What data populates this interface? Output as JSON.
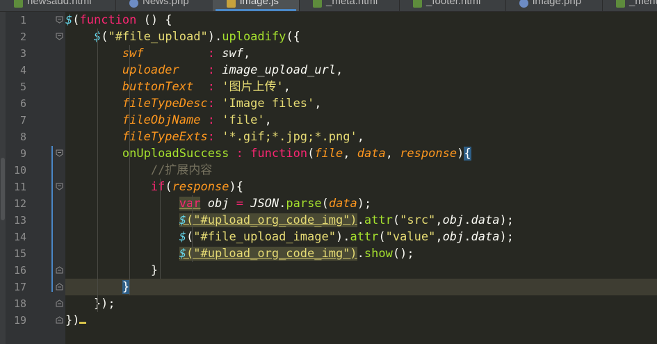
{
  "tabs": [
    {
      "label": "newsadd.html",
      "icon": "html-file-icon",
      "active": false
    },
    {
      "label": "News.php",
      "icon": "php-file-icon",
      "active": false
    },
    {
      "label": "image.js",
      "icon": "js-file-icon",
      "active": true
    },
    {
      "label": "_meta.html",
      "icon": "html-file-icon",
      "active": false
    },
    {
      "label": "_footer.html",
      "icon": "html-file-icon",
      "active": false
    },
    {
      "label": "image.php",
      "icon": "php-file-icon",
      "active": false
    },
    {
      "label": "_menu",
      "icon": "html-file-icon",
      "active": false
    }
  ],
  "line_numbers": [
    "1",
    "2",
    "3",
    "4",
    "5",
    "6",
    "7",
    "8",
    "9",
    "10",
    "11",
    "12",
    "13",
    "14",
    "15",
    "16",
    "17",
    "18",
    "19"
  ],
  "code_lines": [
    [
      [
        "fn",
        "$"
      ],
      [
        "punct",
        "("
      ],
      [
        "kw",
        "function"
      ],
      [
        "punct",
        " () {"
      ]
    ],
    [
      [
        "punct",
        "    "
      ],
      [
        "fn",
        "$"
      ],
      [
        "punct",
        "("
      ],
      [
        "str",
        "\"#file_upload\""
      ],
      [
        "punct",
        ")."
      ],
      [
        "method",
        "uploadify"
      ],
      [
        "punct",
        "({"
      ]
    ],
    [
      [
        "punct",
        "        "
      ],
      [
        "prop",
        "swf"
      ],
      [
        "punct",
        "         "
      ],
      [
        "kw",
        ":"
      ],
      [
        "punct",
        " "
      ],
      [
        "var",
        "swf"
      ],
      [
        "punct",
        ","
      ]
    ],
    [
      [
        "punct",
        "        "
      ],
      [
        "prop",
        "uploader"
      ],
      [
        "punct",
        "    "
      ],
      [
        "kw",
        ":"
      ],
      [
        "punct",
        " "
      ],
      [
        "var",
        "image_upload_url"
      ],
      [
        "punct",
        ","
      ]
    ],
    [
      [
        "punct",
        "        "
      ],
      [
        "prop",
        "buttonText"
      ],
      [
        "punct",
        "  "
      ],
      [
        "kw",
        ":"
      ],
      [
        "punct",
        " "
      ],
      [
        "str",
        "'图片上传'"
      ],
      [
        "punct",
        ","
      ]
    ],
    [
      [
        "punct",
        "        "
      ],
      [
        "prop",
        "fileTypeDesc"
      ],
      [
        "kw",
        ":"
      ],
      [
        "punct",
        " "
      ],
      [
        "str",
        "'Image files'"
      ],
      [
        "punct",
        ","
      ]
    ],
    [
      [
        "punct",
        "        "
      ],
      [
        "prop",
        "fileObjName"
      ],
      [
        "punct",
        " "
      ],
      [
        "kw",
        ":"
      ],
      [
        "punct",
        " "
      ],
      [
        "str",
        "'file'"
      ],
      [
        "punct",
        ","
      ]
    ],
    [
      [
        "punct",
        "        "
      ],
      [
        "prop",
        "fileTypeExts"
      ],
      [
        "kw",
        ":"
      ],
      [
        "punct",
        " "
      ],
      [
        "str",
        "'*.gif;*.jpg;*.png'"
      ],
      [
        "punct",
        ","
      ]
    ],
    [
      [
        "punct",
        "        "
      ],
      [
        "method",
        "onUploadSuccess"
      ],
      [
        "punct",
        " "
      ],
      [
        "kw",
        ":"
      ],
      [
        "punct",
        " "
      ],
      [
        "kw",
        "function"
      ],
      [
        "punct",
        "("
      ],
      [
        "param",
        "file"
      ],
      [
        "punct",
        ", "
      ],
      [
        "param",
        "data"
      ],
      [
        "punct",
        ", "
      ],
      [
        "param",
        "response"
      ],
      [
        "punct",
        ")"
      ],
      [
        "brace",
        "{"
      ]
    ],
    [
      [
        "punct",
        "            "
      ],
      [
        "cmt",
        "//扩展内容"
      ]
    ],
    [
      [
        "punct",
        "            "
      ],
      [
        "kw",
        "if"
      ],
      [
        "punct",
        "("
      ],
      [
        "param",
        "response"
      ],
      [
        "punct",
        "){"
      ]
    ],
    [
      [
        "punct",
        "                "
      ],
      [
        "kwhl",
        "var"
      ],
      [
        "punct",
        " "
      ],
      [
        "var",
        "obj"
      ],
      [
        "punct",
        " "
      ],
      [
        "kw",
        "="
      ],
      [
        "punct",
        " "
      ],
      [
        "var",
        "JSON"
      ],
      [
        "punct",
        "."
      ],
      [
        "method",
        "parse"
      ],
      [
        "punct",
        "("
      ],
      [
        "param",
        "data"
      ],
      [
        "punct",
        ");"
      ]
    ],
    [
      [
        "punct",
        "                "
      ],
      [
        "fnhl",
        "$"
      ],
      [
        "hl",
        "(\"#upload_org_code_img\")"
      ],
      [
        "punct",
        "."
      ],
      [
        "method",
        "attr"
      ],
      [
        "punct",
        "("
      ],
      [
        "str",
        "\"src\""
      ],
      [
        "punct",
        ","
      ],
      [
        "var",
        "obj"
      ],
      [
        "punct",
        "."
      ],
      [
        "var",
        "data"
      ],
      [
        "punct",
        ");"
      ]
    ],
    [
      [
        "punct",
        "                "
      ],
      [
        "fn",
        "$"
      ],
      [
        "punct",
        "("
      ],
      [
        "str",
        "\"#file_upload_image\""
      ],
      [
        "punct",
        ")."
      ],
      [
        "method",
        "attr"
      ],
      [
        "punct",
        "("
      ],
      [
        "str",
        "\"value\""
      ],
      [
        "punct",
        ","
      ],
      [
        "var",
        "obj"
      ],
      [
        "punct",
        "."
      ],
      [
        "var",
        "data"
      ],
      [
        "punct",
        ");"
      ]
    ],
    [
      [
        "punct",
        "                "
      ],
      [
        "fnhl",
        "$"
      ],
      [
        "hl",
        "(\"#upload_org_code_img\")"
      ],
      [
        "punct",
        "."
      ],
      [
        "method",
        "show"
      ],
      [
        "punct",
        "();"
      ]
    ],
    [
      [
        "punct",
        "            }"
      ]
    ],
    [
      [
        "punct",
        "        "
      ],
      [
        "brace",
        "}"
      ]
    ],
    [
      [
        "punct",
        "    });"
      ]
    ],
    [
      [
        "punct",
        "})"
      ],
      [
        "cursor",
        ""
      ]
    ]
  ],
  "current_line": 17,
  "colors": {
    "background": "#272822",
    "keyword": "#f92672",
    "string": "#e6db74",
    "property": "#fd971f",
    "method": "#a6e22e",
    "comment": "#75715e"
  }
}
